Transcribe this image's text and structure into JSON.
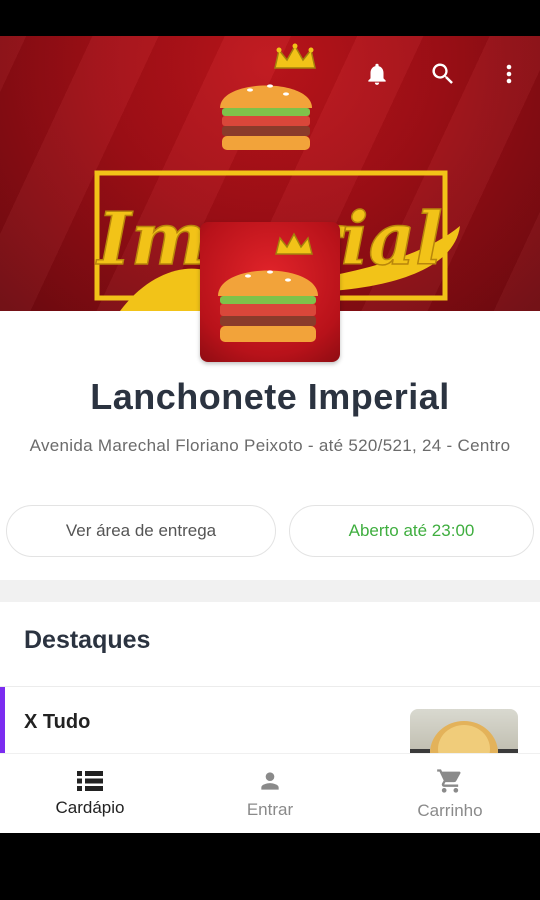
{
  "store": {
    "name": "Lanchonete Imperial",
    "address": "Avenida Marechal Floriano Peixoto - até 520/521, 24 - Centro",
    "banner_logo_text": "Imperial"
  },
  "actions": {
    "delivery_area": "Ver área de entrega",
    "open_status": "Aberto até 23:00"
  },
  "highlights": {
    "title": "Destaques",
    "items": [
      {
        "name": "X Tudo",
        "description": ""
      }
    ]
  },
  "bottom_nav": {
    "items": [
      {
        "label": "Cardápio",
        "icon": "list-icon",
        "active": true
      },
      {
        "label": "Entrar",
        "icon": "person-icon",
        "active": false
      },
      {
        "label": "Carrinho",
        "icon": "cart-icon",
        "active": false
      }
    ]
  },
  "icons": {
    "notifications": "bell-icon",
    "search": "search-icon",
    "more": "more-vert-icon"
  },
  "colors": {
    "banner": "#a10f16",
    "logo_gold": "#f2c318",
    "open_status": "#3fae3f",
    "highlight_accent": "#7b2cf0",
    "text_dark": "#2b3340"
  }
}
